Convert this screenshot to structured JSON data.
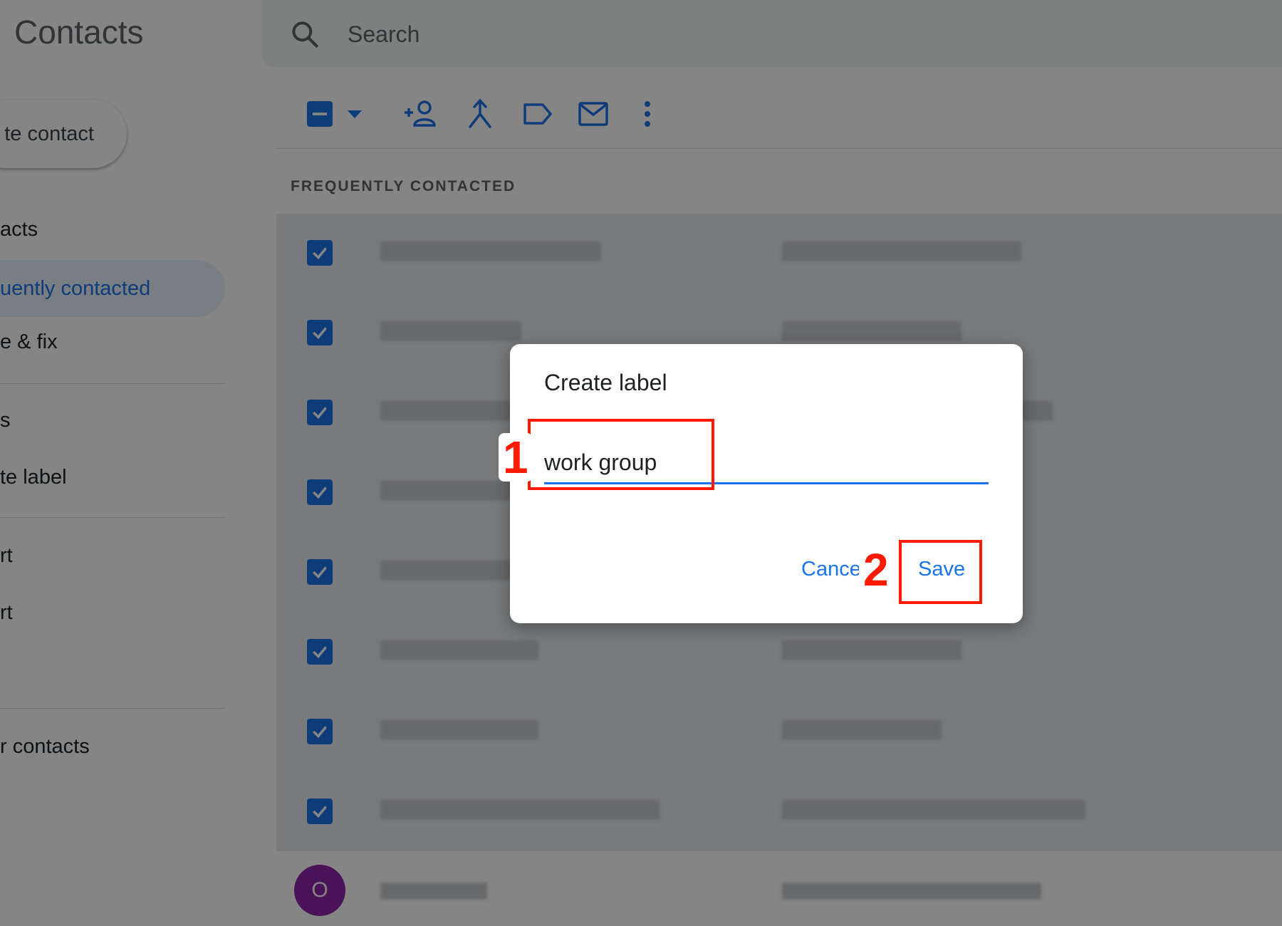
{
  "app": {
    "title": "Contacts"
  },
  "search": {
    "placeholder": "Search",
    "icon": "search-icon"
  },
  "sidebar": {
    "create_button": "te contact",
    "items": [
      {
        "label": "acts"
      },
      {
        "label": "uently contacted",
        "active": true
      },
      {
        "label": "e & fix"
      },
      {
        "label": "s"
      },
      {
        "label": "te label"
      },
      {
        "label": "rt"
      },
      {
        "label": "rt"
      },
      {
        "label": "r contacts"
      }
    ]
  },
  "toolbar": {
    "icons": [
      "select-all-checkbox-icon",
      "select-dropdown-icon",
      "add-to-contacts-icon",
      "merge-icon",
      "label-icon",
      "email-icon",
      "more-options-icon"
    ]
  },
  "list": {
    "section_label": "FREQUENTLY CONTACTED",
    "avatar_letter": "O"
  },
  "dialog": {
    "title": "Create label",
    "input_value": "work group",
    "cancel_label": "Cancel",
    "save_label": "Save"
  },
  "annotations": {
    "step1": "1",
    "step2": "2"
  },
  "colors": {
    "accent": "#1a73e8",
    "annotation": "#ff1a00",
    "avatar": "#8e24aa"
  }
}
